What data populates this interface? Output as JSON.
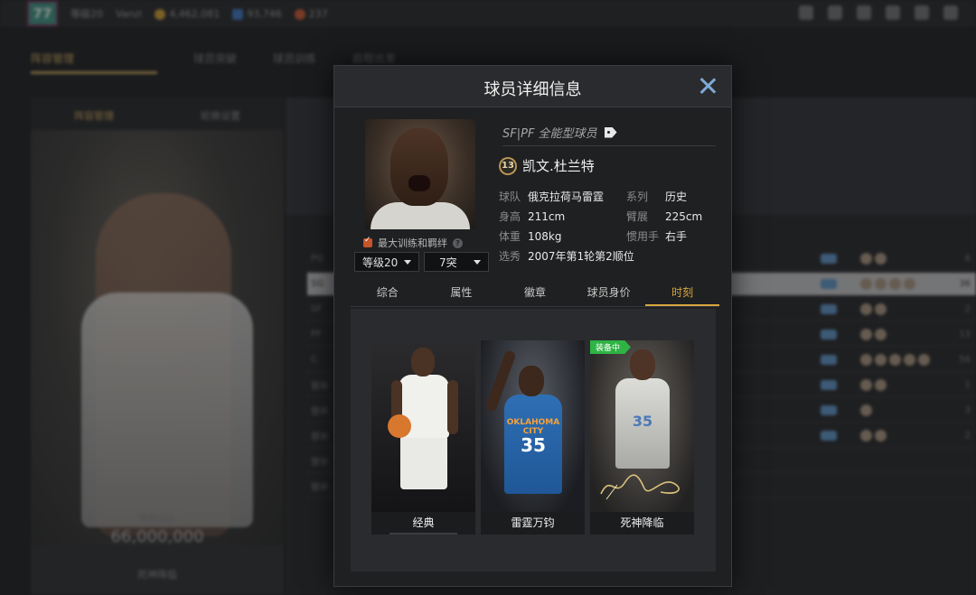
{
  "background": {
    "topbar": {
      "level": "77",
      "user_text": "等级20",
      "user_name": "Vanzi",
      "gold": "4,462,081",
      "gems": "93,746",
      "tickets": "237"
    },
    "tabs": [
      "阵容管理",
      "球员突破",
      "球员训练",
      "启程出发"
    ],
    "left_panel": {
      "tabs": [
        "阵容管理",
        "轮换设置"
      ],
      "price_label": "阵容估价",
      "price": "66,000,000",
      "footer": "死神降临"
    },
    "rows": [
      {
        "pos": "PG",
        "num": "6"
      },
      {
        "pos": "SG",
        "num": "36"
      },
      {
        "pos": "SF",
        "num": "2"
      },
      {
        "pos": "PF",
        "num": "13"
      },
      {
        "pos": "C",
        "num": "56"
      },
      {
        "pos": "替补",
        "num": "1"
      },
      {
        "pos": "替补",
        "num": "3"
      },
      {
        "pos": "替补",
        "num": "2"
      },
      {
        "pos": "替补",
        "num": ""
      },
      {
        "pos": "替补",
        "num": ""
      }
    ]
  },
  "modal": {
    "title": "球员详细信息",
    "close_icon": "close-icon",
    "role": "SF|PF 全能型球员",
    "role_icon": "tag-icon",
    "jersey_number": "13",
    "player_name": "凯文.杜兰特",
    "info": {
      "team_label": "球队",
      "team": "俄克拉荷马雷霆",
      "series_label": "系列",
      "series": "历史",
      "height_label": "身高",
      "height": "211cm",
      "wingspan_label": "臂展",
      "wingspan": "225cm",
      "weight_label": "体重",
      "weight": "108kg",
      "hand_label": "惯用手",
      "hand": "右手",
      "draft_label": "选秀",
      "draft": "2007年第1轮第2顺位"
    },
    "training_label": "最大训练和羁绊",
    "level_select": "等级20",
    "breakthrough_select": "7突",
    "tabs": [
      "综合",
      "属性",
      "徽章",
      "球员身价",
      "时刻"
    ],
    "active_tab": "时刻",
    "moments": [
      {
        "label": "经典",
        "equipped": false
      },
      {
        "label": "雷霆万钧",
        "equipped": false,
        "jersey_text": "OKLAHOMA CITY",
        "jersey_number": "35"
      },
      {
        "label": "死神降临",
        "equipped": true,
        "badge": "装备中",
        "jersey_number": "35"
      }
    ]
  },
  "colors": {
    "accent_gold": "#d7a63e",
    "close_blue": "#7fa9d6",
    "equip_green": "#2fb344",
    "thunder_blue": "#2f6fb4"
  }
}
